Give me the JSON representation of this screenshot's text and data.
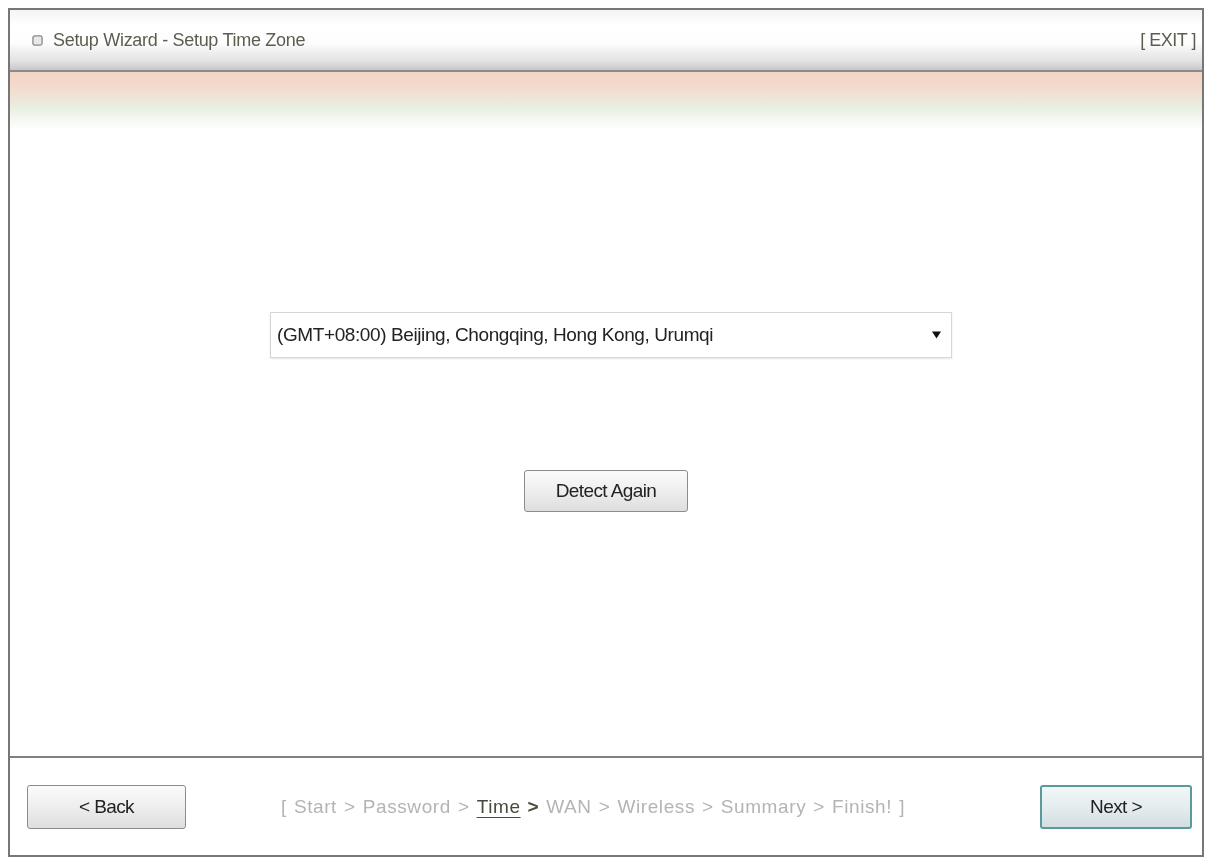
{
  "window": {
    "title": "Setup Wizard - Setup Time Zone",
    "exit_link": "[ EXIT ]"
  },
  "timezone_select": {
    "value": "(GMT+08:00) Beijing, Chongqing, Hong Kong, Urumqi"
  },
  "detect_button": {
    "label": "Detect Again"
  },
  "footer": {
    "back_button": {
      "label": "< Back",
      "focused": false
    },
    "progress": {
      "open": "[",
      "close": "]",
      "steps": [
        {
          "label": "Start",
          "selected": false,
          "separator": ">"
        },
        {
          "label": "Password",
          "selected": false,
          "separator": ">"
        },
        {
          "label": "Time",
          "selected": true,
          "separator": ">"
        },
        {
          "label": "WAN",
          "selected": false,
          "separator": ">"
        },
        {
          "label": "Wireless",
          "selected": false,
          "separator": ">"
        },
        {
          "label": "Summary",
          "selected": false,
          "separator": ">"
        },
        {
          "label": "Finish!",
          "selected": false
        }
      ]
    },
    "next_button": {
      "label": "Next >",
      "focused": true
    }
  }
}
